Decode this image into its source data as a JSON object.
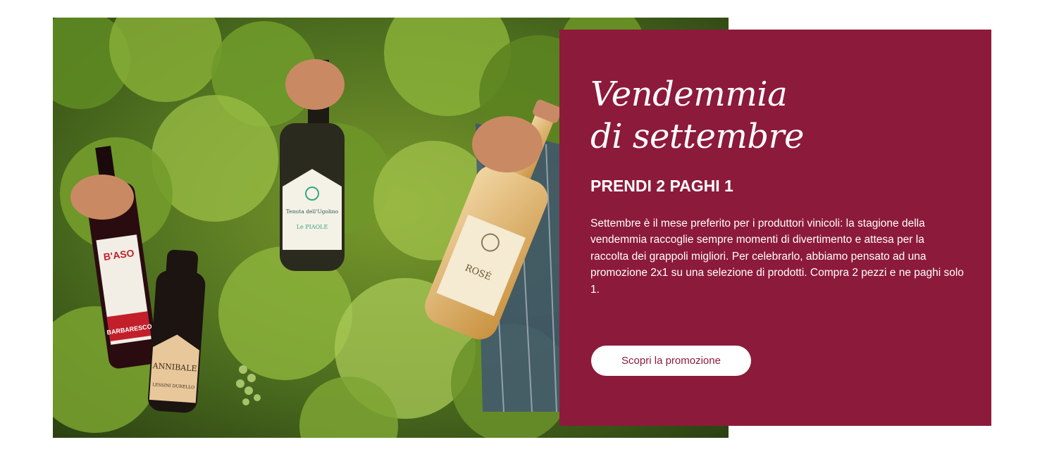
{
  "promo": {
    "title": "Vendemmia di settembre",
    "subtitle": "PRENDI 2 PAGHI 1",
    "body": "Settembre è il mese preferito per i produttori vinicoli: la stagione della vendemmia raccoglie sempre momenti di divertimento e attesa per la raccolta dei grappoli migliori. Per celebrarlo, abbiamo pensato ad una promozione 2x1 su una selezione di prodotti. Compra 2 pezzi e ne paghi solo 1.",
    "button_label": "Scopri la promozione"
  },
  "bottles": {
    "b1_name": "B'ASO",
    "b1_sub": "BARBARESCO",
    "b2_name": "ANNIBALE",
    "b2_sub": "LESSINI DURELLO",
    "b3_name": "Tenuta dell'Ugolino",
    "b3_sub": "Le PIAOLE",
    "b4_name": "ROSÉ"
  },
  "colors": {
    "panel": "#8c1a3b",
    "button_bg": "#ffffff",
    "button_text": "#8c1a3b"
  }
}
